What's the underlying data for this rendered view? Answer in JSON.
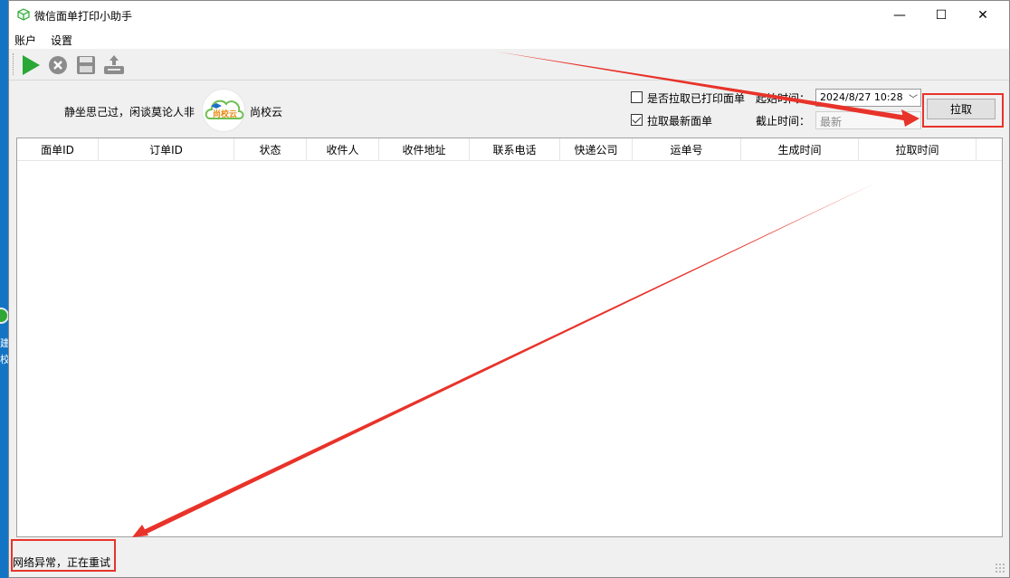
{
  "window": {
    "title": "微信面单打印小助手",
    "controls": {
      "minimize": "—",
      "maximize": "☐",
      "close": "✕"
    }
  },
  "menu": [
    "账户",
    "设置"
  ],
  "toolbar": {
    "icons": [
      "play-icon",
      "stop-icon",
      "save-icon",
      "upload-printer-icon"
    ]
  },
  "header": {
    "slogan": "静坐思己过，闲谈莫论人非",
    "logo_text": "尚校云",
    "brand": "尚校云"
  },
  "filters": {
    "pull_printed_label": "是否拉取已打印面单",
    "pull_printed_checked": false,
    "pull_latest_label": "拉取最新面单",
    "pull_latest_checked": true,
    "start_time_label": "起始时间：",
    "start_time_value": "2024/8/27 10:28",
    "end_time_label": "截止时间：",
    "end_time_value": "最新",
    "pull_button": "拉取"
  },
  "table": {
    "columns": [
      "面单ID",
      "订单ID",
      "状态",
      "收件人",
      "收件地址",
      "联系电话",
      "快递公司",
      "运单号",
      "生成时间",
      "拉取时间"
    ],
    "rows": []
  },
  "status_bar": {
    "text": "网络异常，正在重试"
  },
  "colors": {
    "accent_red": "#e8332a",
    "play_green": "#2aa836",
    "toolbar_gray": "#8c8c8c"
  },
  "desktop": {
    "glyphs": [
      "建",
      "校"
    ]
  }
}
